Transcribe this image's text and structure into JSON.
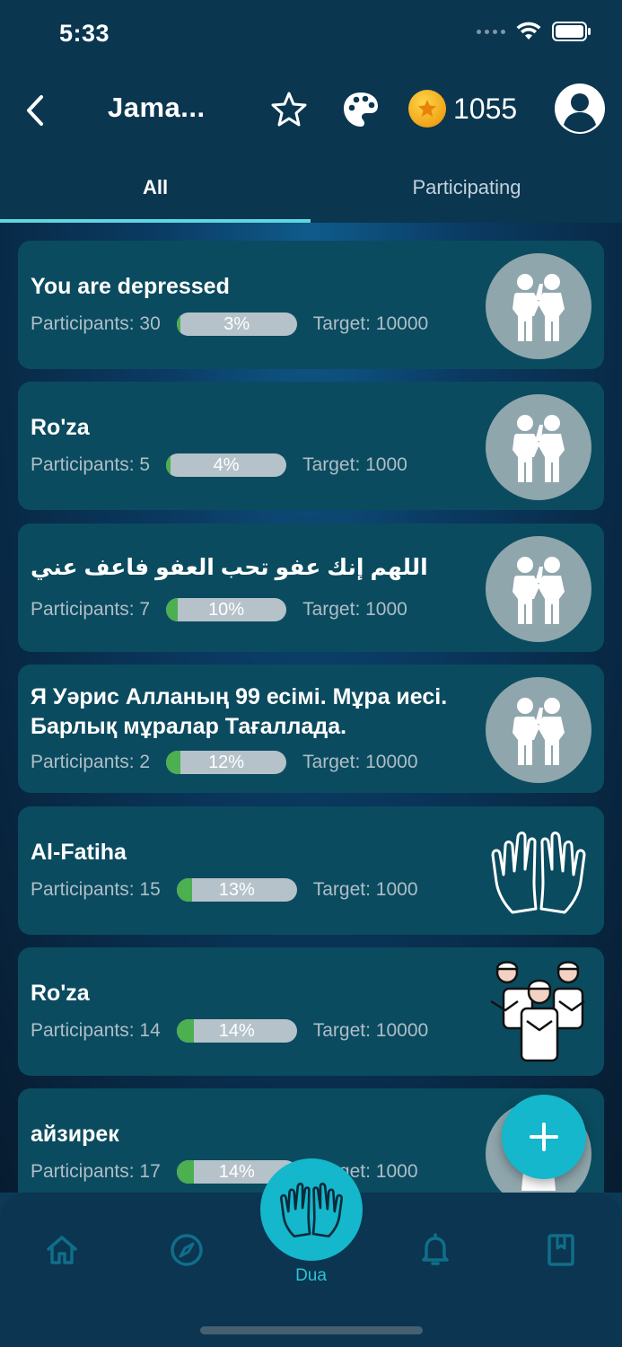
{
  "status_bar": {
    "time": "5:33"
  },
  "header": {
    "title": "Jama...",
    "coins": "1055"
  },
  "tabs": [
    {
      "label": "All"
    },
    {
      "label": "Participating"
    }
  ],
  "cards": [
    {
      "title": "You are depressed",
      "participants": "Participants: 30",
      "progress_label": "3%",
      "progress": 3,
      "target": "Target: 10000",
      "icon": "two-people-icon"
    },
    {
      "title": "Ro'za",
      "participants": "Participants: 5",
      "progress_label": "4%",
      "progress": 4,
      "target": "Target: 1000",
      "icon": "two-people-icon"
    },
    {
      "title": "اللهم إنك عفو تحب العفو فاعف عني",
      "participants": "Participants: 7",
      "progress_label": "10%",
      "progress": 10,
      "target": "Target: 1000",
      "icon": "two-people-icon"
    },
    {
      "title": " Я Уәрис Алланың 99 есімі. Мұра иесі. Барлық мұралар Тағаллада.",
      "participants": "Participants: 2",
      "progress_label": "12%",
      "progress": 12,
      "target": "Target: 10000",
      "icon": "two-people-icon"
    },
    {
      "title": "Al-Fatiha",
      "participants": "Participants: 15",
      "progress_label": "13%",
      "progress": 13,
      "target": "Target: 1000",
      "icon": "praying-hands-icon"
    },
    {
      "title": "Ro'za",
      "participants": "Participants: 14",
      "progress_label": "14%",
      "progress": 14,
      "target": "Target: 10000",
      "icon": "praying-group-icon"
    },
    {
      "title": "айзирек",
      "participants": "Participants: 17",
      "progress_label": "14%",
      "progress": 14,
      "target": "Target: 1000",
      "icon": "praying-group-icon"
    }
  ],
  "bottom_nav": {
    "dua_label": "Dua"
  },
  "colors": {
    "accent": "#14b7cb",
    "progress": "#4caf50",
    "card": "#0b4b5f"
  }
}
